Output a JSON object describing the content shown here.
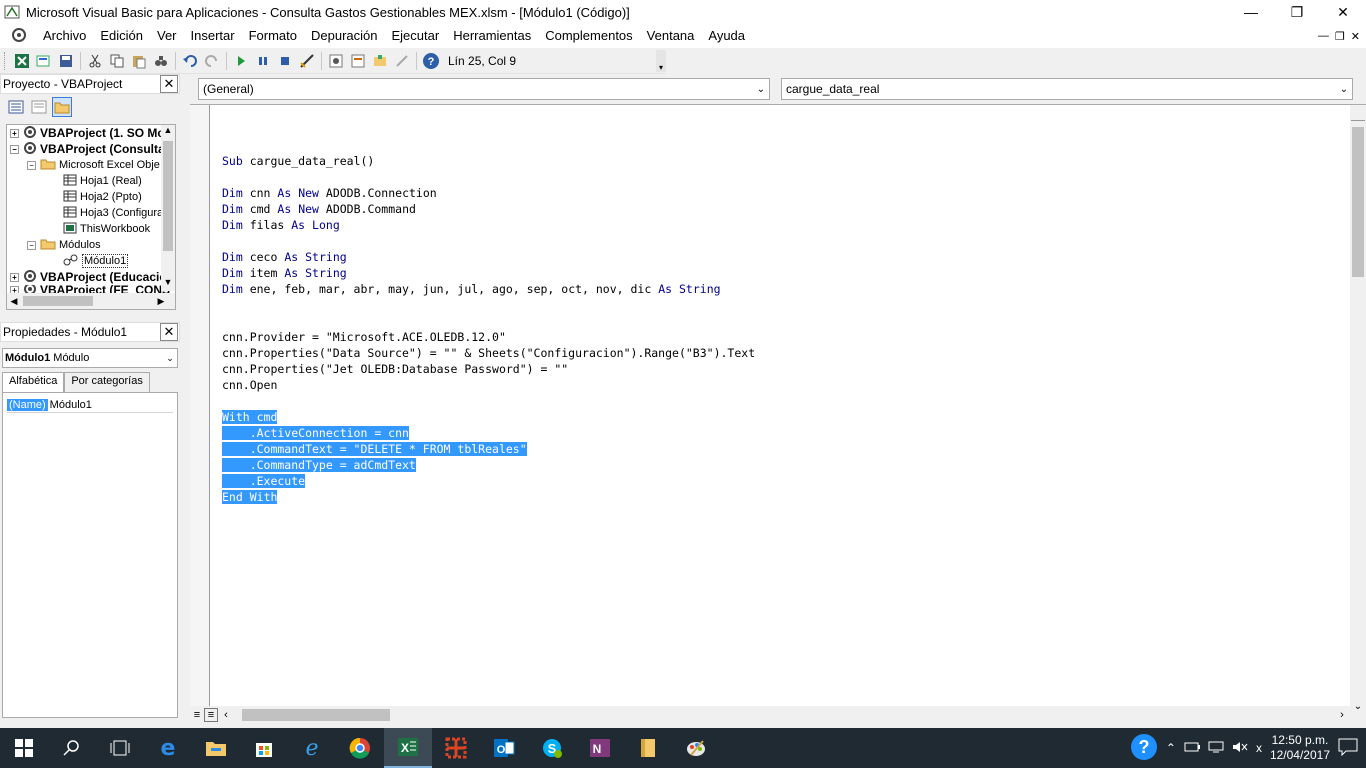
{
  "window": {
    "title": "Microsoft Visual Basic para Aplicaciones - Consulta  Gastos Gestionables MEX.xlsm - [Módulo1 (Código)]"
  },
  "menu": {
    "items": [
      "Archivo",
      "Edición",
      "Ver",
      "Insertar",
      "Formato",
      "Depuración",
      "Ejecutar",
      "Herramientas",
      "Complementos",
      "Ventana",
      "Ayuda"
    ]
  },
  "toolbar": {
    "position": "Lín 25, Col 9"
  },
  "project": {
    "title": "Proyecto - VBAProject",
    "tree": [
      {
        "label": "VBAProject (1. SO Mc",
        "bold": true
      },
      {
        "label": "VBAProject (Consulta",
        "bold": true
      },
      {
        "label": "Microsoft Excel Obje",
        "bold": false
      },
      {
        "label": "Hoja1 (Real)",
        "bold": false
      },
      {
        "label": "Hoja2 (Ppto)",
        "bold": false
      },
      {
        "label": "Hoja3 (Configura",
        "bold": false
      },
      {
        "label": "ThisWorkbook",
        "bold": false
      },
      {
        "label": "Módulos",
        "bold": false
      },
      {
        "label": "Módulo1",
        "bold": false
      },
      {
        "label": "VBAProject (Educacio",
        "bold": true
      },
      {
        "label": "VBAProject (FE_CONS",
        "bold": true
      }
    ]
  },
  "properties": {
    "title": "Propiedades - Módulo1",
    "object_name": "Módulo1",
    "object_type": "Módulo",
    "tabs": [
      "Alfabética",
      "Por categorías"
    ],
    "rows": [
      {
        "name": "(Name)",
        "value": "Módulo1"
      }
    ]
  },
  "code": {
    "object_combo": "(General)",
    "proc_combo": "cargue_data_real",
    "lines": [
      "Sub cargue_data_real()",
      "",
      "Dim cnn As New ADODB.Connection",
      "Dim cmd As New ADODB.Command",
      "Dim filas As Long",
      "",
      "Dim ceco As String",
      "Dim item As String",
      "Dim ene, feb, mar, abr, may, jun, jul, ago, sep, oct, nov, dic As String",
      "",
      "",
      "cnn.Provider = \"Microsoft.ACE.OLEDB.12.0\"",
      "cnn.Properties(\"Data Source\") = \"\" & Sheets(\"Configuracion\").Range(\"B3\").Text",
      "cnn.Properties(\"Jet OLEDB:Database Password\") = \"\"",
      "cnn.Open",
      "",
      "With cmd",
      "    .ActiveConnection = cnn",
      "    .CommandText = \"DELETE * FROM tblReales\"",
      "    .CommandType = adCmdText",
      "    .Execute",
      "End With"
    ]
  },
  "taskbar": {
    "time": "12:50 p.m.",
    "date": "12/04/2017"
  }
}
